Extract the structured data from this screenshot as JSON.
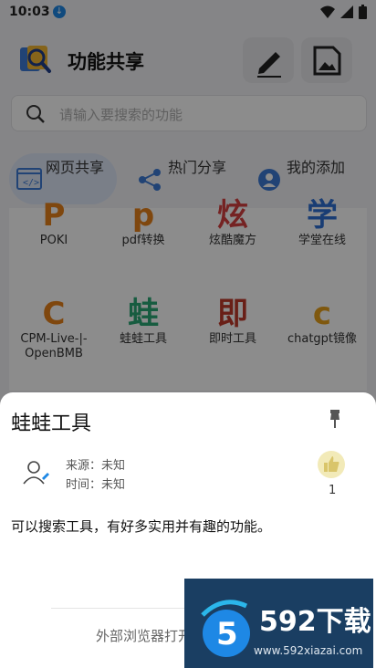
{
  "status_bar": {
    "time": "10:03"
  },
  "header": {
    "title": "功能共享"
  },
  "search": {
    "placeholder": "请输入要搜索的功能"
  },
  "tabs": [
    {
      "label": "网页共享",
      "active": true
    },
    {
      "label": "热门分享",
      "active": false
    },
    {
      "label": "我的添加",
      "active": false
    }
  ],
  "grid": {
    "items": [
      {
        "initial": "P",
        "name": "POKI",
        "color": "#e8821b"
      },
      {
        "initial": "p",
        "name": "pdf转换",
        "color": "#e8821b"
      },
      {
        "initial": "炫",
        "name": "炫酷魔方",
        "color": "#d64040"
      },
      {
        "initial": "学",
        "name": "学堂在线",
        "color": "#2e6fd4"
      },
      {
        "initial": "C",
        "name": "CPM-Live-|-OpenBMB",
        "color": "#e8821b"
      },
      {
        "initial": "蛙",
        "name": "蛙蛙工具",
        "color": "#2aa876"
      },
      {
        "initial": "即",
        "name": "即时工具",
        "color": "#c0392b"
      },
      {
        "initial": "c",
        "name": "chatgpt镜像",
        "color": "#e8a01b"
      }
    ]
  },
  "dialog": {
    "title": "蛙蛙工具",
    "source_label": "来源：未知",
    "time_label": "时间：未知",
    "like_count": "1",
    "description": "可以搜索工具，有好多实用并有趣的功能。",
    "open_button": "外部浏览器打开"
  },
  "watermark": {
    "brand": "592下载",
    "url": "www.592xiazai.com"
  }
}
